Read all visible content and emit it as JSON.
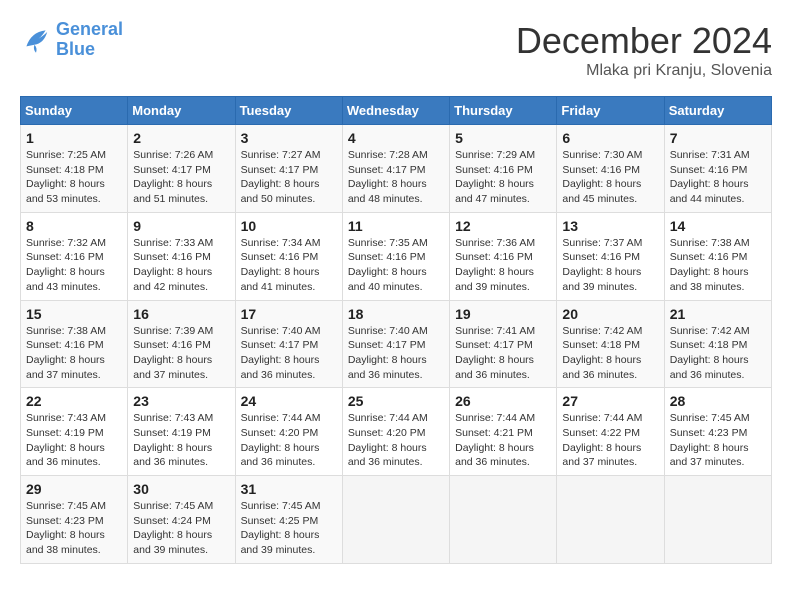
{
  "header": {
    "logo_line1": "General",
    "logo_line2": "Blue",
    "month": "December 2024",
    "location": "Mlaka pri Kranju, Slovenia"
  },
  "weekdays": [
    "Sunday",
    "Monday",
    "Tuesday",
    "Wednesday",
    "Thursday",
    "Friday",
    "Saturday"
  ],
  "weeks": [
    [
      {
        "day": "1",
        "sunrise": "Sunrise: 7:25 AM",
        "sunset": "Sunset: 4:18 PM",
        "daylight": "Daylight: 8 hours and 53 minutes."
      },
      {
        "day": "2",
        "sunrise": "Sunrise: 7:26 AM",
        "sunset": "Sunset: 4:17 PM",
        "daylight": "Daylight: 8 hours and 51 minutes."
      },
      {
        "day": "3",
        "sunrise": "Sunrise: 7:27 AM",
        "sunset": "Sunset: 4:17 PM",
        "daylight": "Daylight: 8 hours and 50 minutes."
      },
      {
        "day": "4",
        "sunrise": "Sunrise: 7:28 AM",
        "sunset": "Sunset: 4:17 PM",
        "daylight": "Daylight: 8 hours and 48 minutes."
      },
      {
        "day": "5",
        "sunrise": "Sunrise: 7:29 AM",
        "sunset": "Sunset: 4:16 PM",
        "daylight": "Daylight: 8 hours and 47 minutes."
      },
      {
        "day": "6",
        "sunrise": "Sunrise: 7:30 AM",
        "sunset": "Sunset: 4:16 PM",
        "daylight": "Daylight: 8 hours and 45 minutes."
      },
      {
        "day": "7",
        "sunrise": "Sunrise: 7:31 AM",
        "sunset": "Sunset: 4:16 PM",
        "daylight": "Daylight: 8 hours and 44 minutes."
      }
    ],
    [
      {
        "day": "8",
        "sunrise": "Sunrise: 7:32 AM",
        "sunset": "Sunset: 4:16 PM",
        "daylight": "Daylight: 8 hours and 43 minutes."
      },
      {
        "day": "9",
        "sunrise": "Sunrise: 7:33 AM",
        "sunset": "Sunset: 4:16 PM",
        "daylight": "Daylight: 8 hours and 42 minutes."
      },
      {
        "day": "10",
        "sunrise": "Sunrise: 7:34 AM",
        "sunset": "Sunset: 4:16 PM",
        "daylight": "Daylight: 8 hours and 41 minutes."
      },
      {
        "day": "11",
        "sunrise": "Sunrise: 7:35 AM",
        "sunset": "Sunset: 4:16 PM",
        "daylight": "Daylight: 8 hours and 40 minutes."
      },
      {
        "day": "12",
        "sunrise": "Sunrise: 7:36 AM",
        "sunset": "Sunset: 4:16 PM",
        "daylight": "Daylight: 8 hours and 39 minutes."
      },
      {
        "day": "13",
        "sunrise": "Sunrise: 7:37 AM",
        "sunset": "Sunset: 4:16 PM",
        "daylight": "Daylight: 8 hours and 39 minutes."
      },
      {
        "day": "14",
        "sunrise": "Sunrise: 7:38 AM",
        "sunset": "Sunset: 4:16 PM",
        "daylight": "Daylight: 8 hours and 38 minutes."
      }
    ],
    [
      {
        "day": "15",
        "sunrise": "Sunrise: 7:38 AM",
        "sunset": "Sunset: 4:16 PM",
        "daylight": "Daylight: 8 hours and 37 minutes."
      },
      {
        "day": "16",
        "sunrise": "Sunrise: 7:39 AM",
        "sunset": "Sunset: 4:16 PM",
        "daylight": "Daylight: 8 hours and 37 minutes."
      },
      {
        "day": "17",
        "sunrise": "Sunrise: 7:40 AM",
        "sunset": "Sunset: 4:17 PM",
        "daylight": "Daylight: 8 hours and 36 minutes."
      },
      {
        "day": "18",
        "sunrise": "Sunrise: 7:40 AM",
        "sunset": "Sunset: 4:17 PM",
        "daylight": "Daylight: 8 hours and 36 minutes."
      },
      {
        "day": "19",
        "sunrise": "Sunrise: 7:41 AM",
        "sunset": "Sunset: 4:17 PM",
        "daylight": "Daylight: 8 hours and 36 minutes."
      },
      {
        "day": "20",
        "sunrise": "Sunrise: 7:42 AM",
        "sunset": "Sunset: 4:18 PM",
        "daylight": "Daylight: 8 hours and 36 minutes."
      },
      {
        "day": "21",
        "sunrise": "Sunrise: 7:42 AM",
        "sunset": "Sunset: 4:18 PM",
        "daylight": "Daylight: 8 hours and 36 minutes."
      }
    ],
    [
      {
        "day": "22",
        "sunrise": "Sunrise: 7:43 AM",
        "sunset": "Sunset: 4:19 PM",
        "daylight": "Daylight: 8 hours and 36 minutes."
      },
      {
        "day": "23",
        "sunrise": "Sunrise: 7:43 AM",
        "sunset": "Sunset: 4:19 PM",
        "daylight": "Daylight: 8 hours and 36 minutes."
      },
      {
        "day": "24",
        "sunrise": "Sunrise: 7:44 AM",
        "sunset": "Sunset: 4:20 PM",
        "daylight": "Daylight: 8 hours and 36 minutes."
      },
      {
        "day": "25",
        "sunrise": "Sunrise: 7:44 AM",
        "sunset": "Sunset: 4:20 PM",
        "daylight": "Daylight: 8 hours and 36 minutes."
      },
      {
        "day": "26",
        "sunrise": "Sunrise: 7:44 AM",
        "sunset": "Sunset: 4:21 PM",
        "daylight": "Daylight: 8 hours and 36 minutes."
      },
      {
        "day": "27",
        "sunrise": "Sunrise: 7:44 AM",
        "sunset": "Sunset: 4:22 PM",
        "daylight": "Daylight: 8 hours and 37 minutes."
      },
      {
        "day": "28",
        "sunrise": "Sunrise: 7:45 AM",
        "sunset": "Sunset: 4:23 PM",
        "daylight": "Daylight: 8 hours and 37 minutes."
      }
    ],
    [
      {
        "day": "29",
        "sunrise": "Sunrise: 7:45 AM",
        "sunset": "Sunset: 4:23 PM",
        "daylight": "Daylight: 8 hours and 38 minutes."
      },
      {
        "day": "30",
        "sunrise": "Sunrise: 7:45 AM",
        "sunset": "Sunset: 4:24 PM",
        "daylight": "Daylight: 8 hours and 39 minutes."
      },
      {
        "day": "31",
        "sunrise": "Sunrise: 7:45 AM",
        "sunset": "Sunset: 4:25 PM",
        "daylight": "Daylight: 8 hours and 39 minutes."
      },
      null,
      null,
      null,
      null
    ]
  ]
}
